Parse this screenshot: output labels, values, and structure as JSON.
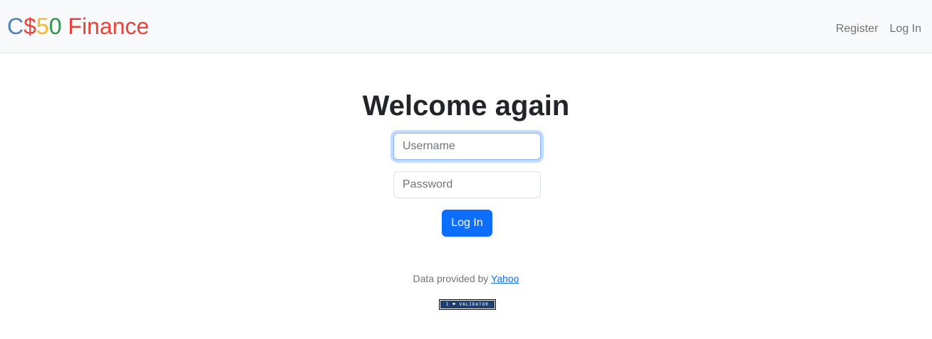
{
  "navbar": {
    "brand": {
      "parts": [
        {
          "text": "C",
          "color": "#537fbe"
        },
        {
          "text": "$",
          "color": "#ea433b"
        },
        {
          "text": "5",
          "color": "#f5b82e"
        },
        {
          "text": "0",
          "color": "#2e944b"
        },
        {
          "text": " Finance",
          "color": "#ea433b"
        }
      ]
    },
    "links": {
      "register": "Register",
      "login": "Log In"
    }
  },
  "main": {
    "heading": "Welcome again",
    "username": {
      "placeholder": "Username",
      "value": ""
    },
    "password": {
      "placeholder": "Password",
      "value": ""
    },
    "submit_label": "Log In"
  },
  "footer": {
    "prefix": "Data provided by ",
    "link_text": "Yahoo",
    "badge_text": "I ♥ VALIDATOR"
  }
}
